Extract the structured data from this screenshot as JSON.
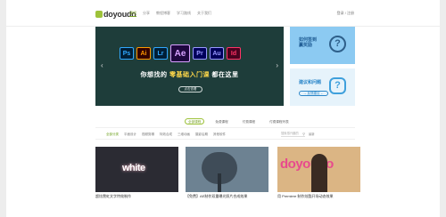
{
  "header": {
    "logo_text": "doyoudo",
    "nav": [
      "课程",
      "分享",
      "教程博客",
      "学习路线",
      "关于我们"
    ],
    "login": "登录 / 注册"
  },
  "banner": {
    "apps": [
      "Ps",
      "Ai",
      "Lr",
      "Ae",
      "Pr",
      "Au",
      "Id"
    ],
    "slogan_pre": "你想找的",
    "slogan_hi": "零基础入门课",
    "slogan_post": "都在这里",
    "sub": "",
    "button": "点击查看",
    "prev_icon": "chevron-left-icon",
    "next_icon": "chevron-right-icon"
  },
  "cards": {
    "card1_title_1": "如何签到",
    "card1_title_2": "赢奖励",
    "card2_title": "建议和问题",
    "card2_pill": "→ 反馈建议 ←"
  },
  "tabs": [
    "全部课程",
    "免费课程",
    "付费课程",
    "付费课程列表"
  ],
  "filters": {
    "items": [
      "全部分类",
      "平面设计",
      "视频剪辑",
      "特效合成",
      "三维动画",
      "摄影后期",
      "其他软件"
    ],
    "search_placeholder": "搜索感兴趣的",
    "right": "最新"
  },
  "courses": [
    {
      "word": "white",
      "title": "超炫霓虹文字特效制作"
    },
    {
      "title": "【免费】AE制作双重曝光照片合成效果"
    },
    {
      "word": "doyoudo",
      "title": "用 Premiere 制作炫酷开场动态效果"
    }
  ],
  "colors": {
    "accent": "#9dc23a",
    "banner_bg": "#1e3d3a",
    "card1": "#8ccaf2",
    "card2": "#e6f3fb"
  }
}
